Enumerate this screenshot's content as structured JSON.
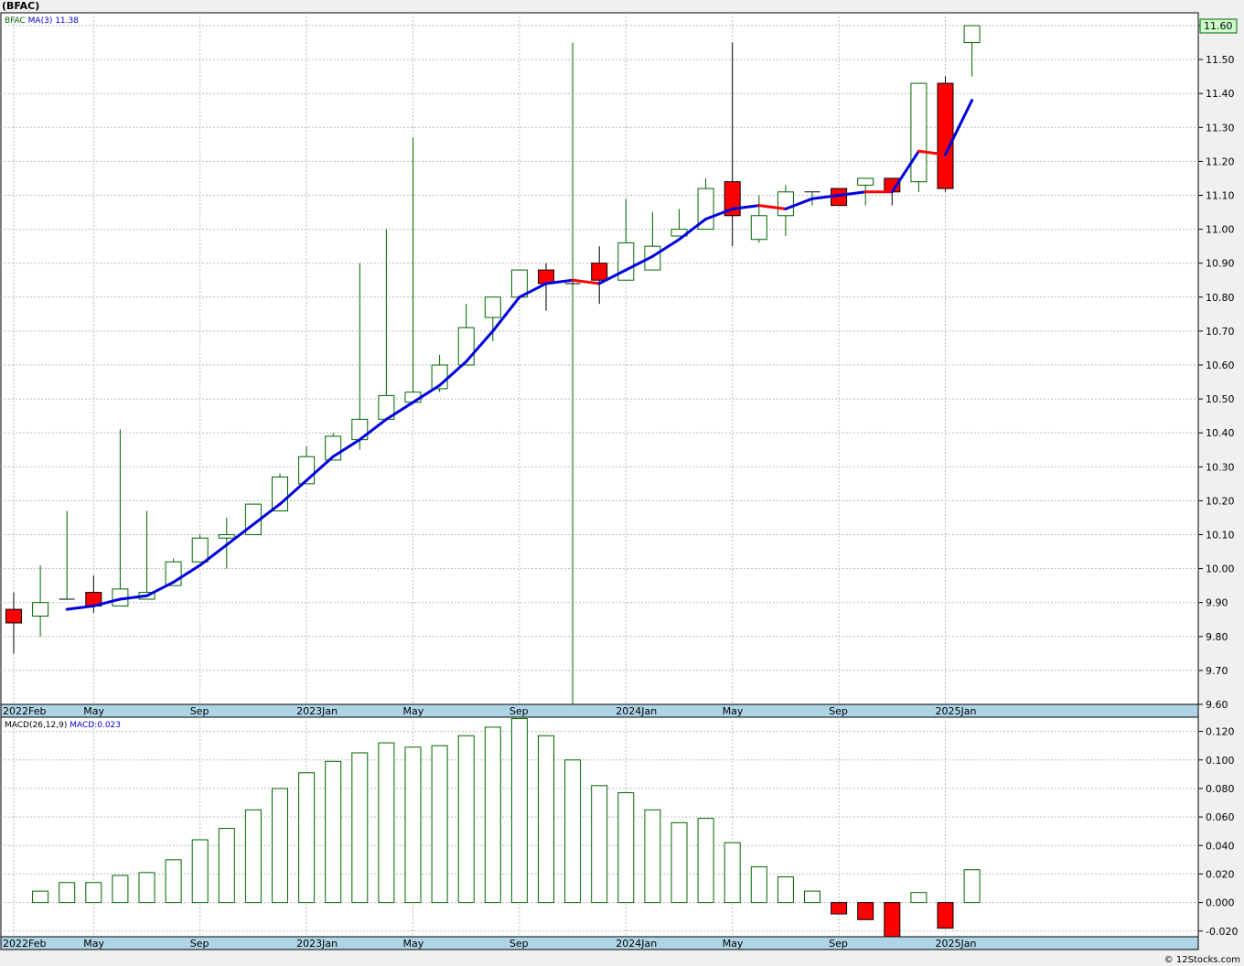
{
  "page": {
    "title": "(BFAC)",
    "footer": "© 12Stocks.com"
  },
  "colors": {
    "up": "#006400",
    "down": "#ff0000",
    "ma": "#0000dd",
    "ma_down": "#ff0000",
    "panel_bg": "#ffffff",
    "axis_strip": "#aed4e6"
  },
  "chart_data": [
    {
      "type": "candlestick",
      "ticker": "BFAC",
      "legend": {
        "symbol": "BFAC",
        "ma_label": "MA(3)",
        "ma_value": "11.38"
      },
      "last_price_label": "11.60",
      "ylim": [
        9.6,
        11.6
      ],
      "yticks": [
        "9.60",
        "9.70",
        "9.80",
        "9.90",
        "10.00",
        "10.10",
        "10.20",
        "10.30",
        "10.40",
        "10.50",
        "10.60",
        "10.70",
        "10.80",
        "10.90",
        "11.00",
        "11.10",
        "11.20",
        "11.30",
        "11.40",
        "11.50",
        "11.60"
      ],
      "x_labels": [
        "2022Feb",
        "May",
        "Sep",
        "2023Jan",
        "May",
        "Sep",
        "2024Jan",
        "May",
        "Sep",
        "2025Jan"
      ],
      "x_label_index": [
        0,
        3,
        7,
        11,
        15,
        19,
        23,
        27,
        31,
        35
      ],
      "candles": [
        {
          "o": 9.88,
          "h": 9.93,
          "l": 9.75,
          "c": 9.84
        },
        {
          "o": 9.86,
          "h": 10.01,
          "l": 9.8,
          "c": 9.9
        },
        {
          "o": 9.91,
          "h": 10.17,
          "l": 9.91,
          "c": 9.91
        },
        {
          "o": 9.93,
          "h": 9.98,
          "l": 9.87,
          "c": 9.89
        },
        {
          "o": 9.89,
          "h": 10.41,
          "l": 9.89,
          "c": 9.94
        },
        {
          "o": 9.91,
          "h": 10.17,
          "l": 9.91,
          "c": 9.93
        },
        {
          "o": 9.95,
          "h": 10.03,
          "l": 9.95,
          "c": 10.02
        },
        {
          "o": 10.02,
          "h": 10.1,
          "l": 10.02,
          "c": 10.09
        },
        {
          "o": 10.09,
          "h": 10.15,
          "l": 10.0,
          "c": 10.1
        },
        {
          "o": 10.1,
          "h": 10.19,
          "l": 10.1,
          "c": 10.19
        },
        {
          "o": 10.17,
          "h": 10.28,
          "l": 10.17,
          "c": 10.27
        },
        {
          "o": 10.25,
          "h": 10.36,
          "l": 10.25,
          "c": 10.33
        },
        {
          "o": 10.32,
          "h": 10.4,
          "l": 10.32,
          "c": 10.39
        },
        {
          "o": 10.38,
          "h": 10.9,
          "l": 10.35,
          "c": 10.44
        },
        {
          "o": 10.44,
          "h": 11.0,
          "l": 10.44,
          "c": 10.51
        },
        {
          "o": 10.49,
          "h": 11.27,
          "l": 10.49,
          "c": 10.52
        },
        {
          "o": 10.53,
          "h": 10.63,
          "l": 10.52,
          "c": 10.6
        },
        {
          "o": 10.6,
          "h": 10.78,
          "l": 10.6,
          "c": 10.71
        },
        {
          "o": 10.74,
          "h": 10.8,
          "l": 10.67,
          "c": 10.8
        },
        {
          "o": 10.8,
          "h": 10.88,
          "l": 10.8,
          "c": 10.88
        },
        {
          "o": 10.88,
          "h": 10.9,
          "l": 10.76,
          "c": 10.84
        },
        {
          "o": 10.84,
          "h": 11.55,
          "l": 9.6,
          "c": 10.84
        },
        {
          "o": 10.9,
          "h": 10.95,
          "l": 10.78,
          "c": 10.85
        },
        {
          "o": 10.85,
          "h": 11.09,
          "l": 10.85,
          "c": 10.96
        },
        {
          "o": 10.88,
          "h": 11.05,
          "l": 10.88,
          "c": 10.95
        },
        {
          "o": 10.98,
          "h": 11.06,
          "l": 10.98,
          "c": 11.0
        },
        {
          "o": 11.0,
          "h": 11.15,
          "l": 11.0,
          "c": 11.12
        },
        {
          "o": 11.14,
          "h": 11.55,
          "l": 10.95,
          "c": 11.04
        },
        {
          "o": 10.97,
          "h": 11.1,
          "l": 10.96,
          "c": 11.04
        },
        {
          "o": 11.04,
          "h": 11.13,
          "l": 10.98,
          "c": 11.11
        },
        {
          "o": 11.11,
          "h": 11.11,
          "l": 11.07,
          "c": 11.11
        },
        {
          "o": 11.12,
          "h": 11.12,
          "l": 11.07,
          "c": 11.07
        },
        {
          "o": 11.13,
          "h": 11.15,
          "l": 11.07,
          "c": 11.15
        },
        {
          "o": 11.15,
          "h": 11.15,
          "l": 11.07,
          "c": 11.11
        },
        {
          "o": 11.14,
          "h": 11.43,
          "l": 11.11,
          "c": 11.43
        },
        {
          "o": 11.43,
          "h": 11.45,
          "l": 11.11,
          "c": 11.12
        },
        {
          "o": 11.55,
          "h": 11.6,
          "l": 11.45,
          "c": 11.6
        }
      ],
      "ma": [
        null,
        null,
        9.88,
        9.89,
        9.91,
        9.92,
        9.96,
        10.01,
        10.07,
        10.13,
        10.19,
        10.26,
        10.33,
        10.38,
        10.44,
        10.49,
        10.54,
        10.61,
        10.7,
        10.8,
        10.84,
        10.85,
        10.84,
        10.88,
        10.92,
        10.97,
        11.03,
        11.06,
        11.07,
        11.06,
        11.09,
        11.1,
        11.11,
        11.11,
        11.23,
        11.22,
        11.38
      ],
      "ma_down": [
        false,
        false,
        false,
        false,
        false,
        false,
        false,
        false,
        false,
        false,
        false,
        false,
        false,
        false,
        false,
        false,
        false,
        false,
        false,
        false,
        false,
        false,
        true,
        false,
        false,
        false,
        false,
        false,
        false,
        true,
        false,
        false,
        false,
        true,
        false,
        true,
        false
      ]
    },
    {
      "type": "bar",
      "legend": {
        "label": "MACD(26,12,9)",
        "value_label": "MACD:0.023"
      },
      "ylim": [
        -0.024,
        0.13
      ],
      "yticks": [
        "-0.020",
        "0.000",
        "0.020",
        "0.040",
        "0.060",
        "0.080",
        "0.100",
        "0.120"
      ],
      "tick_values": [
        -0.02,
        0.0,
        0.02,
        0.04,
        0.06,
        0.08,
        0.1,
        0.12
      ],
      "x_labels": [
        "2022Feb",
        "May",
        "Sep",
        "2023Jan",
        "May",
        "Sep",
        "2024Jan",
        "May",
        "Sep",
        "2025Jan"
      ],
      "x_label_index": [
        0,
        3,
        7,
        11,
        15,
        19,
        23,
        27,
        31,
        35
      ],
      "values": [
        null,
        0.008,
        0.014,
        0.014,
        0.019,
        0.021,
        0.03,
        0.044,
        0.052,
        0.065,
        0.08,
        0.091,
        0.099,
        0.105,
        0.112,
        0.109,
        0.11,
        0.117,
        0.123,
        0.129,
        0.117,
        0.1,
        0.082,
        0.077,
        0.065,
        0.056,
        0.059,
        0.042,
        0.025,
        0.018,
        0.008,
        -0.008,
        -0.012,
        -0.024,
        0.007,
        -0.018,
        0.023
      ],
      "negative_filled": true
    }
  ]
}
